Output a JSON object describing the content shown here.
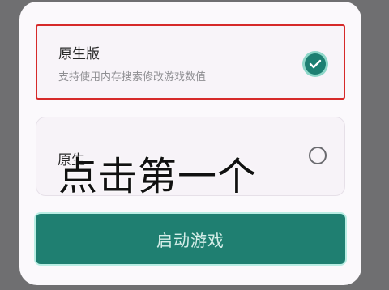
{
  "dialog": {
    "options": [
      {
        "title": "原生版",
        "description": "支持使用内存搜索修改游戏数值",
        "selected": true
      },
      {
        "title": "原生",
        "description": "",
        "selected": false
      }
    ],
    "overlay_text": "点击第一个",
    "start_button_label": "启动游戏"
  },
  "colors": {
    "overlay_background": "#6f6f71",
    "dialog_background": "#fbf9fc",
    "selection_border": "#d62a2a",
    "accent": "#1f7f71",
    "accent_highlight": "#8ed7c9"
  },
  "icons": {
    "selected_indicator": "check-circle-icon",
    "unselected_indicator": "radio-unchecked-icon"
  }
}
